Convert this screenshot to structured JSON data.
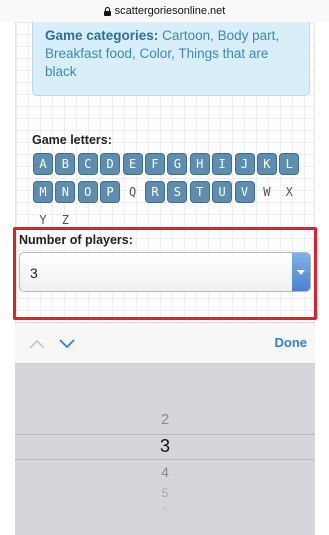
{
  "browser": {
    "url": "scattergoriesonline.net",
    "lock_icon": "lock-icon"
  },
  "categories": {
    "label": "Game categories:",
    "text": "Cartoon, Body part, Breakfast food, Color, Things that are black"
  },
  "letters": {
    "label": "Game letters:",
    "rows": [
      [
        {
          "l": "A",
          "on": true
        },
        {
          "l": "B",
          "on": true
        },
        {
          "l": "C",
          "on": true
        },
        {
          "l": "D",
          "on": true
        },
        {
          "l": "E",
          "on": true
        },
        {
          "l": "F",
          "on": true
        },
        {
          "l": "G",
          "on": true
        },
        {
          "l": "H",
          "on": true
        },
        {
          "l": "I",
          "on": true
        },
        {
          "l": "J",
          "on": true
        },
        {
          "l": "K",
          "on": true
        },
        {
          "l": "L",
          "on": true
        }
      ],
      [
        {
          "l": "M",
          "on": true
        },
        {
          "l": "N",
          "on": true
        },
        {
          "l": "O",
          "on": true
        },
        {
          "l": "P",
          "on": true
        },
        {
          "l": "Q",
          "on": false
        },
        {
          "l": "R",
          "on": true
        },
        {
          "l": "S",
          "on": true
        },
        {
          "l": "T",
          "on": true
        },
        {
          "l": "U",
          "on": true
        },
        {
          "l": "V",
          "on": true
        },
        {
          "l": "W",
          "on": false
        },
        {
          "l": "X",
          "on": false
        }
      ],
      [
        {
          "l": "Y",
          "on": false
        },
        {
          "l": "Z",
          "on": false
        }
      ]
    ]
  },
  "players": {
    "label": "Number of players:",
    "value": "3"
  },
  "toolbar": {
    "prev_icon": "chevron-up-icon",
    "next_icon": "chevron-down-icon",
    "done_label": "Done"
  },
  "picker": {
    "items": [
      "2",
      "3",
      "4",
      "5",
      "6"
    ],
    "selected": "3"
  },
  "colors": {
    "letter_active": "#5d8eb0",
    "highlight_border": "#e0202a",
    "done_blue": "#2f7fe0"
  }
}
